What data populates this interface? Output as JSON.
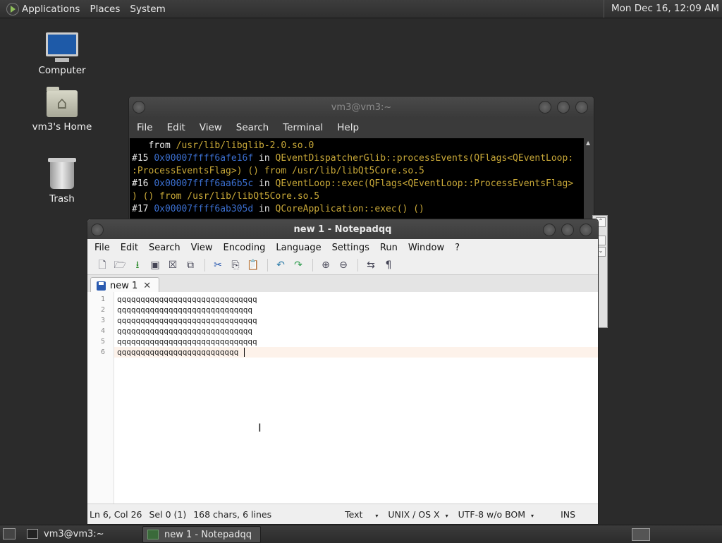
{
  "top_panel": {
    "menus": [
      "Applications",
      "Places",
      "System"
    ],
    "clock": "Mon Dec 16, 12:09 AM"
  },
  "desktop": {
    "icons": [
      {
        "label": "Computer",
        "icon": "monitor-icon"
      },
      {
        "label": "vm3's Home",
        "icon": "home-folder-icon"
      },
      {
        "label": "Trash",
        "icon": "trash-icon"
      }
    ]
  },
  "terminal": {
    "title": "vm3@vm3:~",
    "menu": [
      "File",
      "Edit",
      "View",
      "Search",
      "Terminal",
      "Help"
    ],
    "lines": [
      [
        {
          "t": "   from ",
          "c": "w"
        },
        {
          "t": "/usr/lib/libglib-2.0.so.0",
          "c": "y"
        }
      ],
      [
        {
          "t": "#15 ",
          "c": "w"
        },
        {
          "t": "0x00007ffff6afe16f",
          "c": "b"
        },
        {
          "t": " in ",
          "c": "w"
        },
        {
          "t": "QEventDispatcherGlib::processEvents(QFlags<QEventLoop:",
          "c": "y"
        }
      ],
      [
        {
          "t": ":ProcessEventsFlag>) () from ",
          "c": "y"
        },
        {
          "t": "/usr/lib/libQt5Core.so.5",
          "c": "y"
        }
      ],
      [
        {
          "t": "#16 ",
          "c": "w"
        },
        {
          "t": "0x00007ffff6aa6b5c",
          "c": "b"
        },
        {
          "t": " in ",
          "c": "w"
        },
        {
          "t": "QEventLoop::exec(QFlags<QEventLoop::ProcessEventsFlag>",
          "c": "y"
        }
      ],
      [
        {
          "t": ") () from ",
          "c": "y"
        },
        {
          "t": "/usr/lib/libQt5Core.so.5",
          "c": "y"
        }
      ],
      [
        {
          "t": "#17 ",
          "c": "w"
        },
        {
          "t": "0x00007ffff6ab305d",
          "c": "b"
        },
        {
          "t": " in ",
          "c": "w"
        },
        {
          "t": "QCoreApplication::exec() ()",
          "c": "y"
        }
      ]
    ]
  },
  "notepad": {
    "title": "new 1 - Notepadqq",
    "menu": [
      "File",
      "Edit",
      "Search",
      "View",
      "Encoding",
      "Language",
      "Settings",
      "Run",
      "Window",
      "?"
    ],
    "tab_label": "new 1",
    "tab_close": "✕",
    "line_numbers": [
      "1",
      "2",
      "3",
      "4",
      "5",
      "6"
    ],
    "lines": [
      "qqqqqqqqqqqqqqqqqqqqqqqqqqqqqq",
      "qqqqqqqqqqqqqqqqqqqqqqqqqqqqq",
      "qqqqqqqqqqqqqqqqqqqqqqqqqqqqqq",
      "qqqqqqqqqqqqqqqqqqqqqqqqqqqqq",
      "qqqqqqqqqqqqqqqqqqqqqqqqqqqqqq",
      "qqqqqqqqqqqqqqqqqqqqqqqqqq"
    ],
    "status": {
      "position": "Ln 6, Col 26",
      "selection": "Sel 0 (1)",
      "stats": "168 chars, 6 lines",
      "language": "Text",
      "eol": "UNIX / OS X",
      "encoding": "UTF-8 w/o BOM",
      "mode": "INS"
    }
  },
  "taskbar": {
    "tasks": [
      {
        "label": "vm3@vm3:~",
        "active": false
      },
      {
        "label": "new 1 - Notepadqq",
        "active": true
      }
    ]
  }
}
